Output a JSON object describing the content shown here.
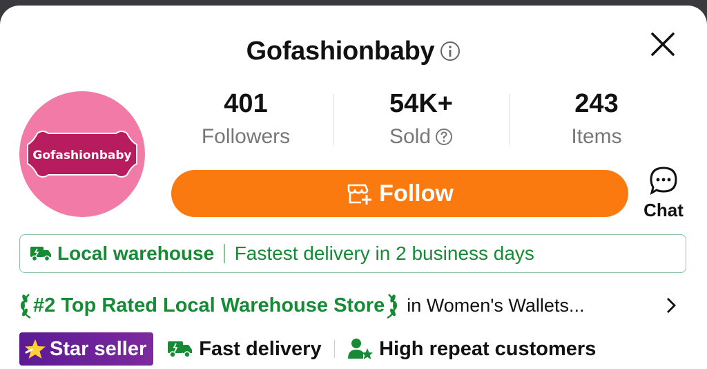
{
  "header": {
    "store_name": "Gofashionbaby",
    "info_icon": "info-circle-icon",
    "close_icon": "close-icon"
  },
  "avatar": {
    "text": "Gofashionbaby",
    "bg_color": "#f27aa6",
    "plaque_color": "#b71c5f"
  },
  "stats": [
    {
      "value": "401",
      "label": "Followers"
    },
    {
      "value": "54K+",
      "label": "Sold",
      "icon": "question-circle-icon"
    },
    {
      "value": "243",
      "label": "Items"
    }
  ],
  "follow_button": {
    "label": "Follow",
    "icon": "store-add-icon",
    "color": "#fb7a0f"
  },
  "chat": {
    "label": "Chat",
    "icon": "chat-bubble-icon"
  },
  "warehouse": {
    "label": "Local warehouse",
    "delivery": "Fastest delivery in 2 business days",
    "icon": "truck-icon",
    "color": "#178a36"
  },
  "ranking": {
    "label": "#2 Top Rated Local Warehouse Store",
    "category": "in Women's Wallets...",
    "icon": "laurel-icon"
  },
  "badges": {
    "star_seller": "Star seller",
    "fast_delivery": "Fast delivery",
    "repeat_customers": "High repeat customers"
  }
}
